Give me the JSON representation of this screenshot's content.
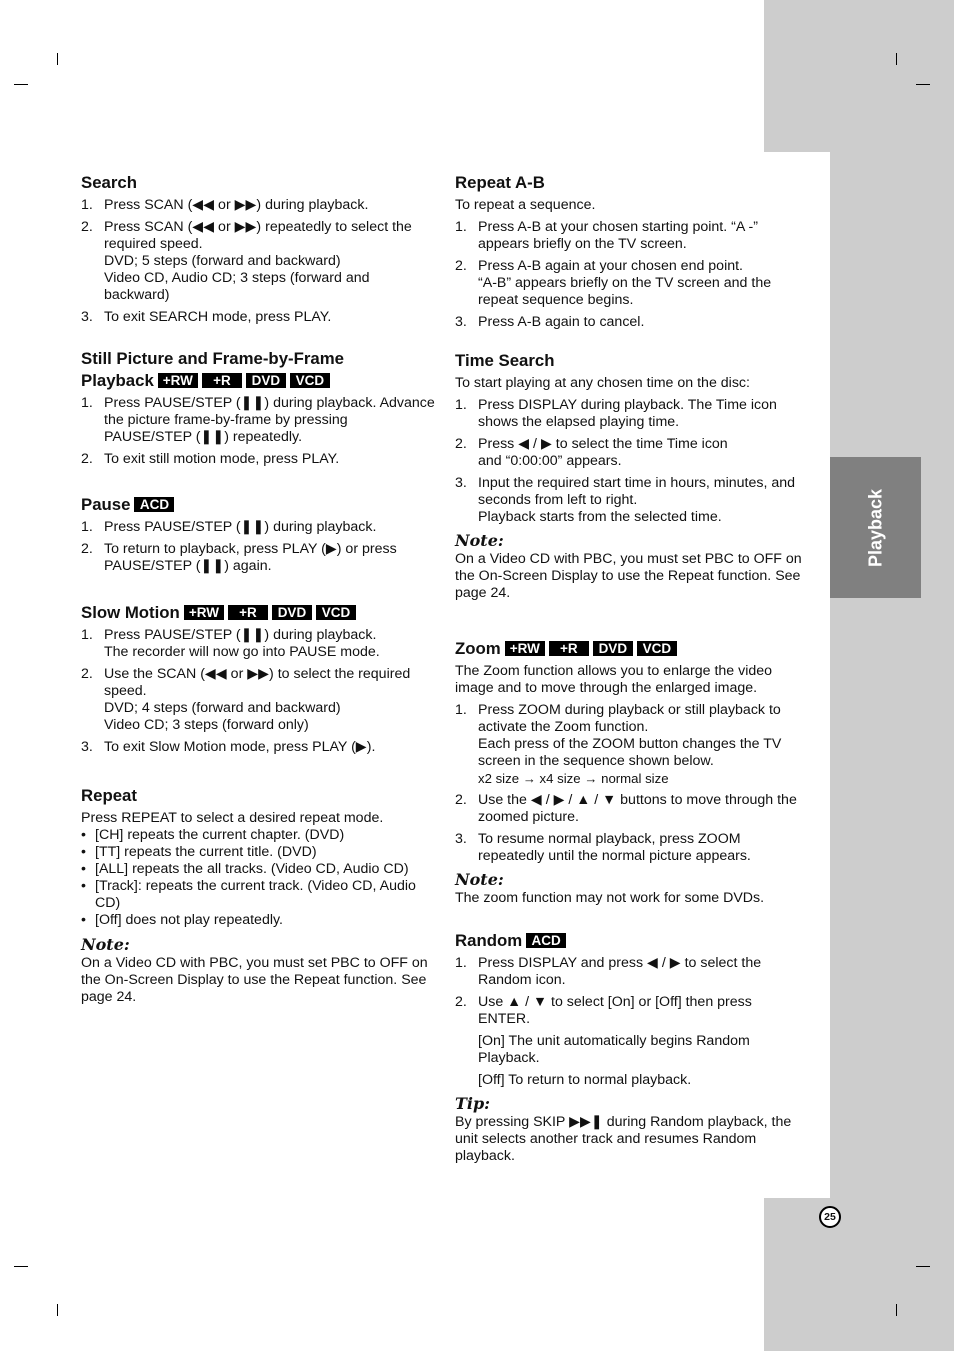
{
  "side_tab": {
    "label": "Playback"
  },
  "page_number": "25",
  "left_column": {
    "search": {
      "title": "Search",
      "steps": [
        {
          "num": "1.",
          "lines": [
            "Press SCAN (◀◀ or ▶▶) during playback."
          ]
        },
        {
          "num": "2.",
          "lines": [
            "Press SCAN (◀◀ or ▶▶) repeatedly to select the required speed.",
            "DVD; 5 steps (forward and backward)",
            "Video CD, Audio CD; 3 steps (forward and backward)"
          ]
        },
        {
          "num": "3.",
          "lines": [
            "To exit SEARCH mode, press PLAY."
          ]
        }
      ]
    },
    "still_picture": {
      "title_line1": "Still Picture and Frame-by-Frame",
      "title_line2": "Playback",
      "badges": [
        "+RW",
        "+R",
        "DVD",
        "VCD"
      ],
      "steps": [
        {
          "num": "1.",
          "lines": [
            "Press PAUSE/STEP (❚❚) during playback. Advance the picture frame-by-frame by pressing PAUSE/STEP (❚❚) repeatedly."
          ]
        },
        {
          "num": "2.",
          "lines": [
            "To exit still motion mode, press PLAY."
          ]
        }
      ]
    },
    "pause": {
      "title": "Pause",
      "badges": [
        "ACD"
      ],
      "steps": [
        {
          "num": "1.",
          "lines": [
            "Press PAUSE/STEP (❚❚) during playback."
          ]
        },
        {
          "num": "2.",
          "lines": [
            "To return to playback, press PLAY (▶) or press PAUSE/STEP (❚❚) again."
          ]
        }
      ]
    },
    "slow_motion": {
      "title": "Slow Motion",
      "badges": [
        "+RW",
        "+R",
        "DVD",
        "VCD"
      ],
      "steps": [
        {
          "num": "1.",
          "lines": [
            "Press PAUSE/STEP (❚❚) during playback.",
            "The recorder will now go into PAUSE mode."
          ]
        },
        {
          "num": "2.",
          "lines": [
            "Use the SCAN (◀◀ or ▶▶) to select the required speed.",
            "DVD; 4 steps (forward and backward)",
            "Video CD; 3 steps (forward only)"
          ]
        },
        {
          "num": "3.",
          "lines": [
            "To exit Slow Motion mode, press PLAY (▶)."
          ]
        }
      ]
    },
    "repeat": {
      "title": "Repeat",
      "intro": "Press REPEAT to select a desired repeat mode.",
      "bullets": [
        "[CH] repeats the current chapter. (DVD)",
        "[TT] repeats the current title. (DVD)",
        "[ALL] repeats the all tracks. (Video CD, Audio CD)",
        "[Track]: repeats the current track. (Video CD, Audio CD)",
        "[Off] does not play repeatedly."
      ],
      "note_label": "Note:",
      "note_text": "On a Video CD with PBC, you must set PBC to OFF on the On-Screen Display to use the Repeat function. See page 24."
    }
  },
  "right_column": {
    "repeat_ab": {
      "title": "Repeat A-B",
      "intro": "To repeat a sequence.",
      "steps": [
        {
          "num": "1.",
          "lines": [
            "Press A-B at your chosen starting point. “A -” appears briefly on the TV screen."
          ]
        },
        {
          "num": "2.",
          "lines": [
            "Press A-B again at your chosen end point.",
            "“A-B” appears briefly on the TV screen and the repeat sequence begins."
          ]
        },
        {
          "num": "3.",
          "lines": [
            "Press A-B again to cancel."
          ]
        }
      ]
    },
    "time_search": {
      "title": "Time Search",
      "intro": "To start playing at any chosen time on the disc:",
      "steps": [
        {
          "num": "1.",
          "lines": [
            "Press DISPLAY during playback. The Time icon shows the elapsed playing time."
          ]
        },
        {
          "num": "2.",
          "lines": [
            "Press ◀ / ▶ to select the time Time icon",
            "and “0:00:00” appears."
          ]
        },
        {
          "num": "3.",
          "lines": [
            "Input the required start time in hours, minutes, and seconds from left to right.",
            "Playback starts from the selected time."
          ]
        }
      ],
      "note_label": "Note:",
      "note_text": "On a Video CD with PBC, you must set PBC to OFF on the On-Screen Display to use the Repeat function. See page 24."
    },
    "zoom": {
      "title": "Zoom",
      "badges": [
        "+RW",
        "+R",
        "DVD",
        "VCD"
      ],
      "intro": "The Zoom function allows you to enlarge the video image and to move through the enlarged image.",
      "steps": [
        {
          "num": "1.",
          "lines": [
            "Press ZOOM during playback or still playback to activate the Zoom function.",
            "Each press of the ZOOM button changes the TV screen in the sequence shown below."
          ],
          "small": "x2 size → x4 size → normal size"
        },
        {
          "num": "2.",
          "lines": [
            "Use the ◀ / ▶ / ▲ / ▼ buttons to move through the zoomed picture."
          ]
        },
        {
          "num": "3.",
          "lines": [
            "To resume normal playback, press ZOOM repeatedly until the normal picture appears."
          ]
        }
      ],
      "note_label": "Note:",
      "note_text": "The zoom function may not work for some DVDs."
    },
    "random": {
      "title": "Random",
      "badges": [
        "ACD"
      ],
      "steps": [
        {
          "num": "1.",
          "lines": [
            "Press DISPLAY and press ◀ / ▶ to select the Random icon."
          ]
        },
        {
          "num": "2.",
          "lines": [
            "Use ▲ / ▼ to select [On] or [Off] then press ENTER."
          ],
          "subs": [
            "[On] The unit automatically begins Random Playback.",
            "[Off] To return to normal playback."
          ]
        }
      ],
      "tip_label": "Tip:",
      "tip_text": "By pressing SKIP ▶▶❚ during Random playback, the unit selects another track and resumes Random playback."
    }
  }
}
